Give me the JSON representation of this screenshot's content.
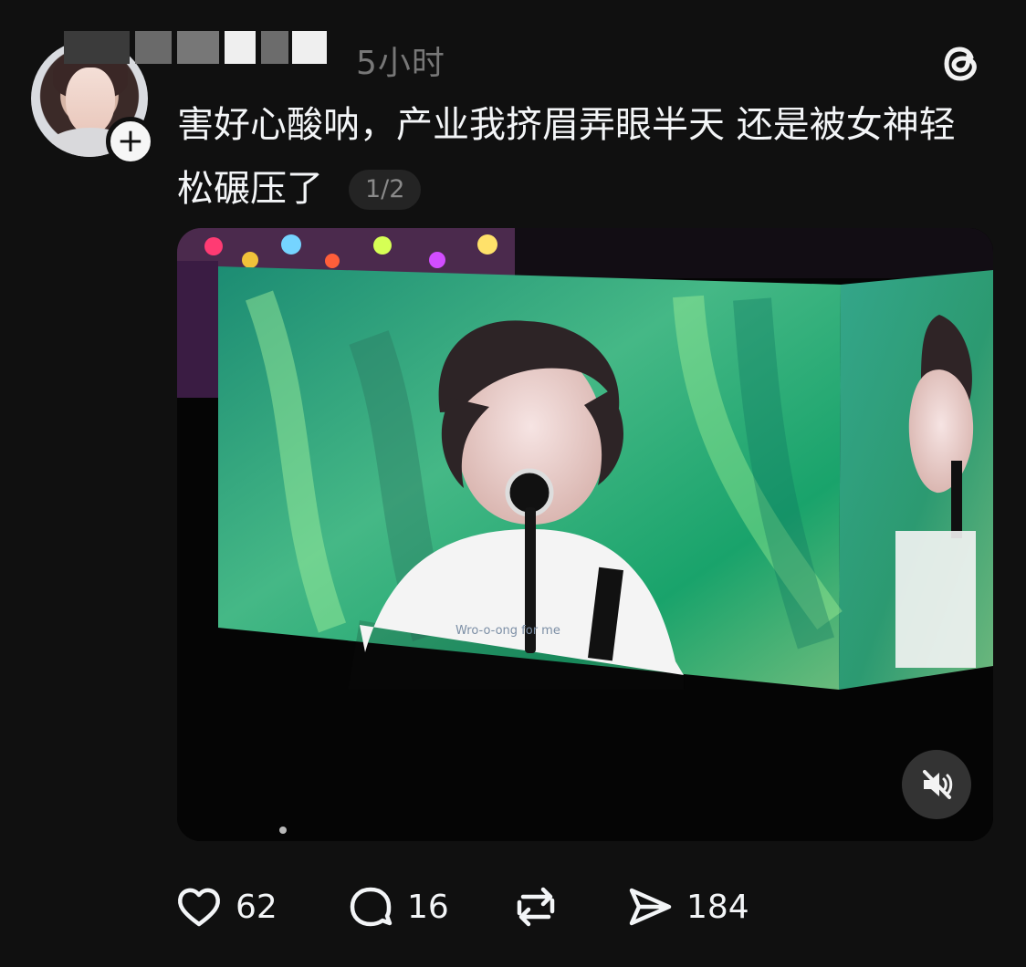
{
  "post": {
    "timestamp": "5小时",
    "text": "害好心酸呐，产业我挤眉弄眼半天 还是被女神轻松碾压了",
    "media_counter": "1/2",
    "video_caption": "Wro-o-ong for me"
  },
  "actions": {
    "like_count": "62",
    "reply_count": "16",
    "repost_label": "",
    "share_count": "184"
  },
  "icons": {
    "threads": "threads-icon",
    "follow": "plus-icon",
    "mute": "muted-speaker-icon",
    "like": "heart-icon",
    "reply": "comment-bubble-icon",
    "repost": "repost-icon",
    "share": "send-icon"
  },
  "colors": {
    "background": "#101010",
    "text": "#f3f5f7",
    "muted_text": "#777777",
    "counter_bg": "#242424"
  }
}
